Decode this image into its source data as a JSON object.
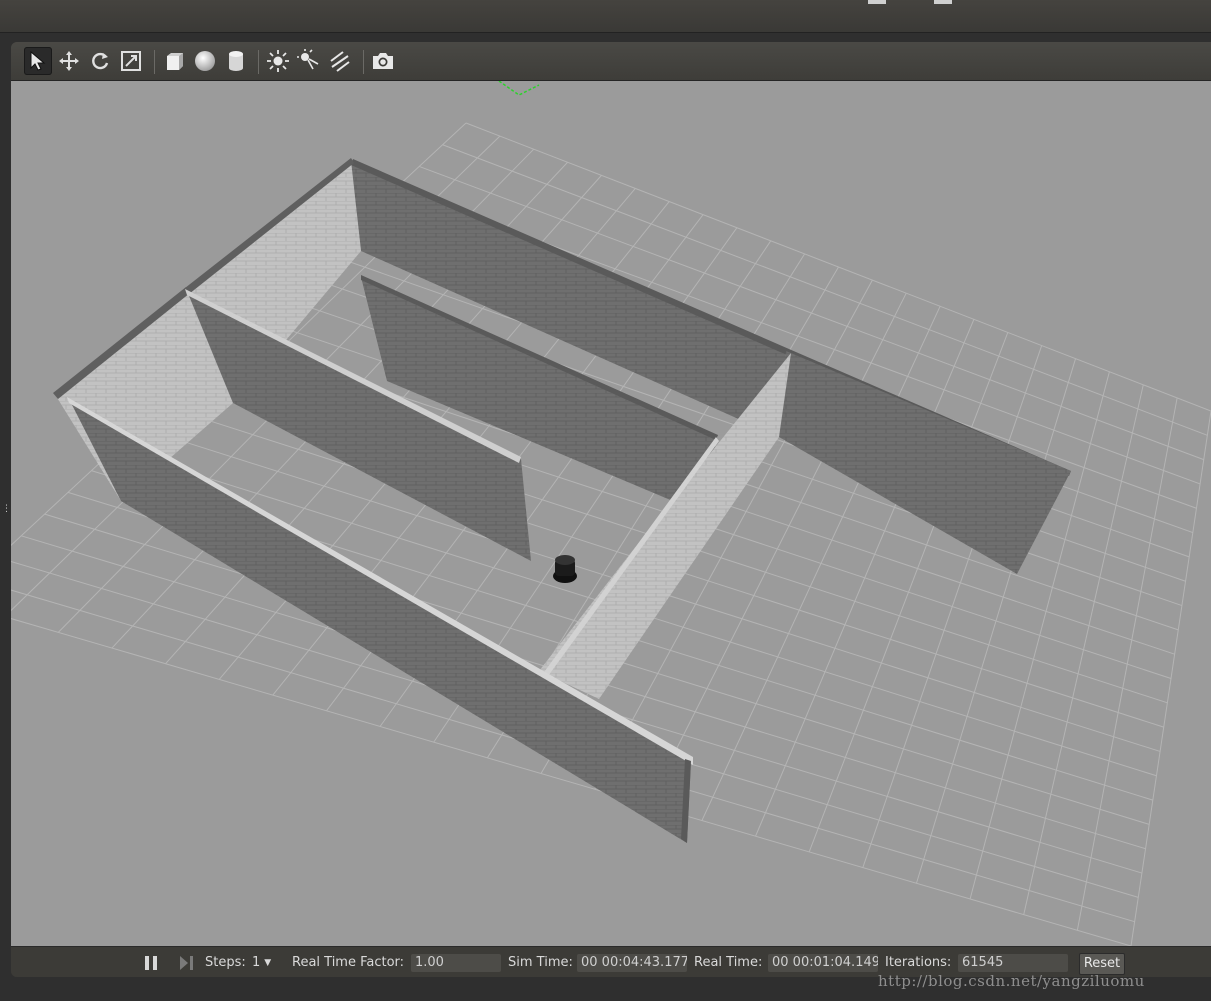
{
  "toolbar": {
    "tools": [
      {
        "name": "select-mode",
        "icon": "arrow-cursor-icon",
        "active": true
      },
      {
        "name": "translate-mode",
        "icon": "move-arrows-icon"
      },
      {
        "name": "rotate-mode",
        "icon": "rotate-icon"
      },
      {
        "name": "scale-mode",
        "icon": "scale-icon"
      },
      {
        "name": "insert-box",
        "icon": "box-icon"
      },
      {
        "name": "insert-sphere",
        "icon": "sphere-icon"
      },
      {
        "name": "insert-cylinder",
        "icon": "cylinder-icon"
      },
      {
        "name": "point-light",
        "icon": "sun-icon"
      },
      {
        "name": "spot-light",
        "icon": "spotlight-icon"
      },
      {
        "name": "directional-light",
        "icon": "directional-light-icon"
      },
      {
        "name": "screenshot",
        "icon": "camera-icon"
      }
    ]
  },
  "statusbar": {
    "steps_label": "Steps:",
    "steps_value": "1",
    "rtf_label": "Real Time Factor:",
    "rtf_value": "1.00",
    "sim_time_label": "Sim Time:",
    "sim_time_value": "00 00:04:43.177",
    "real_time_label": "Real Time:",
    "real_time_value": "00 00:01:04.149",
    "iterations_label": "Iterations:",
    "iterations_value": "61545",
    "reset_label": "Reset"
  },
  "watermark": "http://blog.csdn.net/yangziluomu",
  "colors": {
    "ground": "#9b9b9b",
    "grid": "#b2b2b2",
    "wall_dark": "#6e6e6e",
    "wall_light": "#c4c4c4",
    "toolbar_bg": "#3c3b37"
  }
}
